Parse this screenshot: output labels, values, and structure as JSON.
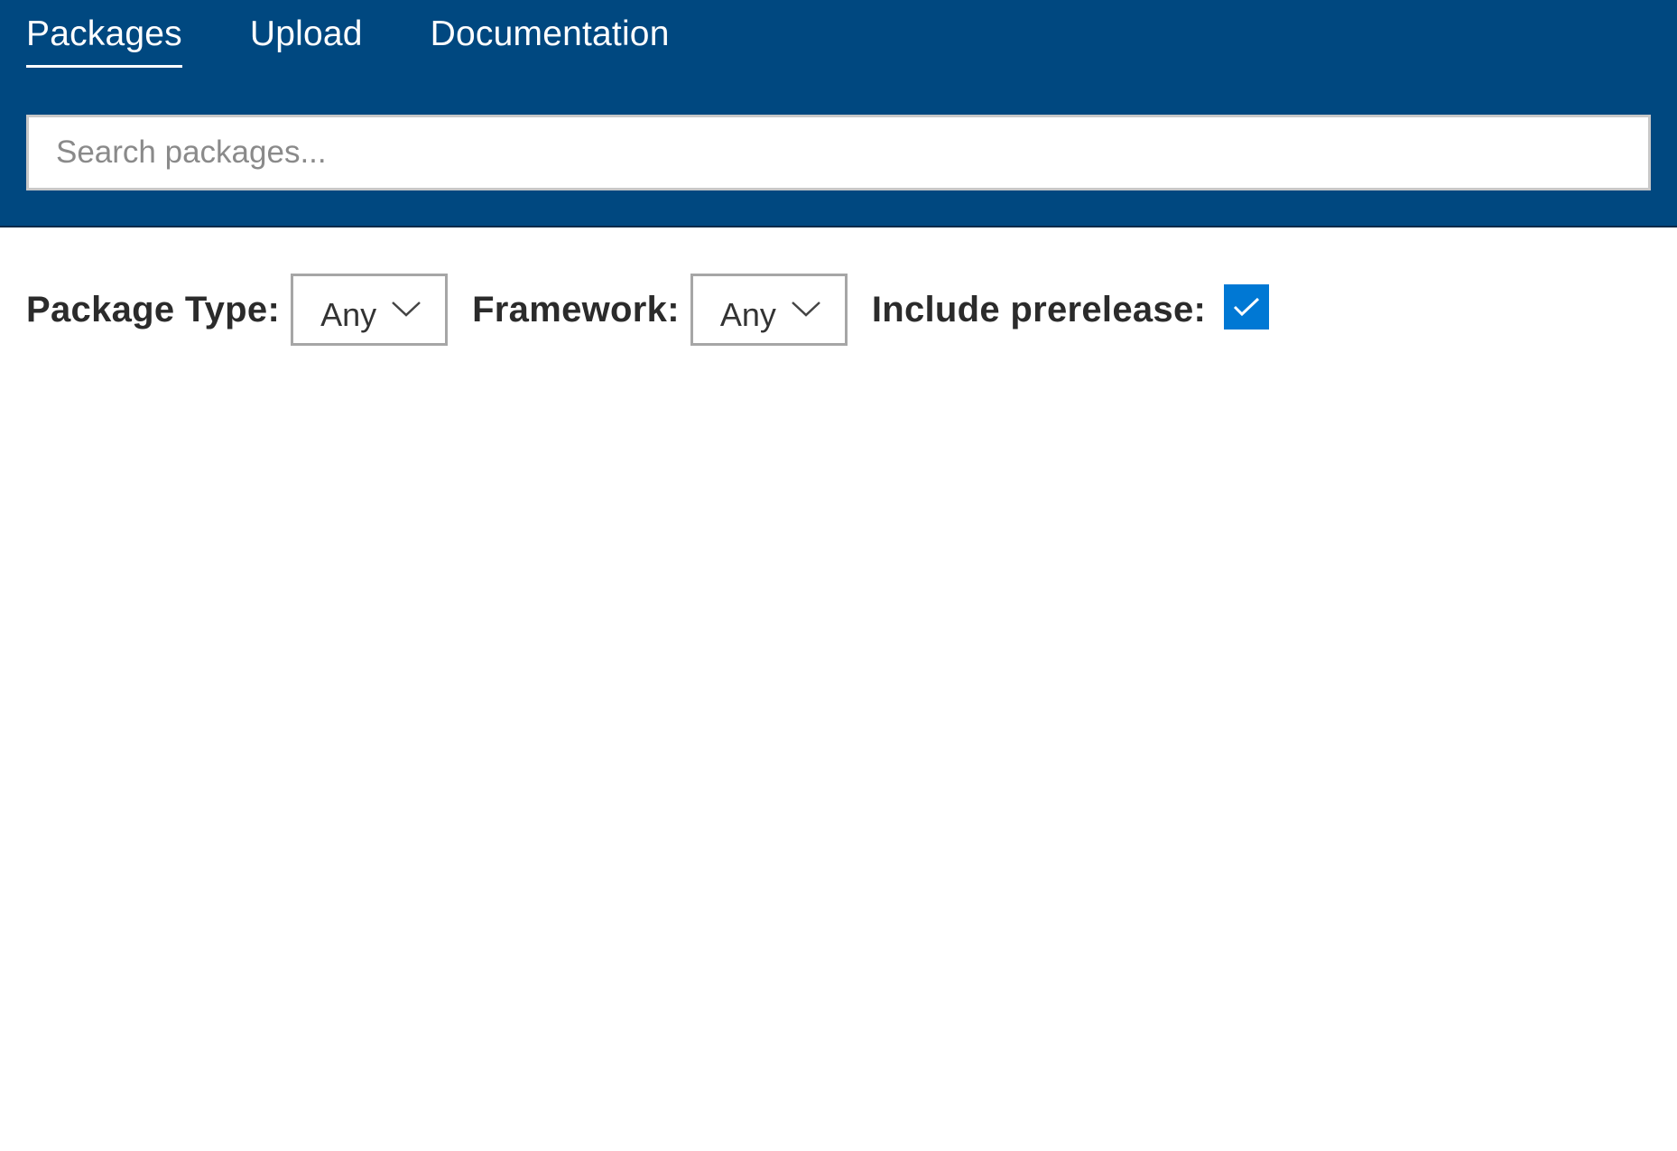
{
  "nav": {
    "tabs": [
      {
        "label": "Packages",
        "active": true
      },
      {
        "label": "Upload",
        "active": false
      },
      {
        "label": "Documentation",
        "active": false
      }
    ]
  },
  "search": {
    "placeholder": "Search packages...",
    "value": ""
  },
  "filters": {
    "package_type": {
      "label": "Package Type:",
      "value": "Any"
    },
    "framework": {
      "label": "Framework:",
      "value": "Any"
    },
    "include_prerelease": {
      "label": "Include prerelease:",
      "checked": true
    }
  },
  "colors": {
    "header_bg": "#004880",
    "checkbox_accent": "#0078d4"
  },
  "icons": {
    "dropdown": "chevron-down-icon",
    "checkbox": "checkmark-icon"
  }
}
